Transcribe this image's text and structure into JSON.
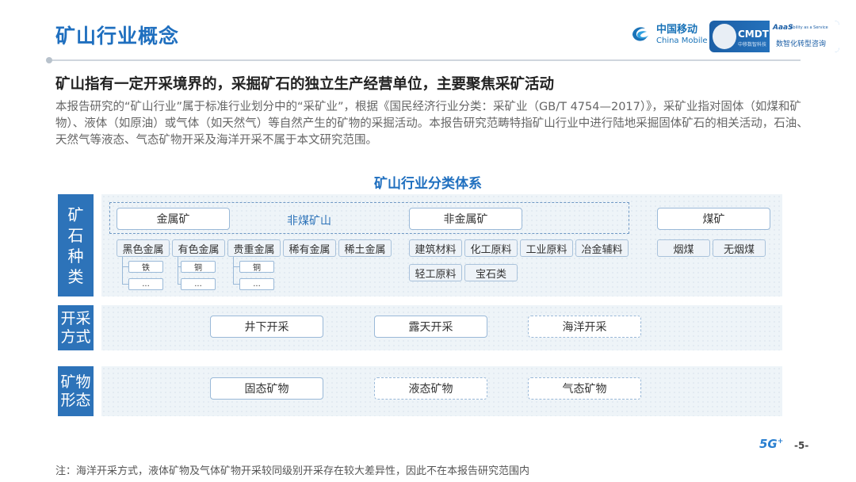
{
  "header": {
    "title": "矿山行业概念",
    "logo_cn": "中国移动",
    "logo_en": "China Mobile",
    "cmdt_brand": "CMDT",
    "cmdt_sub": "中移数智科技",
    "aas": "AaaS",
    "aas_tagline": "Ability as a Service",
    "cmdt_cn": "数智化转型咨询"
  },
  "headline": "矿山指有一定开采境界的，采掘矿石的独立生产经营单位，主要聚焦采矿活动",
  "paragraph": "本报告研究的“矿山行业”属于标准行业划分中的“采矿业”，根据《国民经济行业分类：采矿业（GB/T 4754—2017）》，采矿业指对固体（如煤和矿物）、液体（如原油）或气体（如天然气）等自然产生的矿物的采掘活动。本报告研究范畴特指矿山行业中进行陆地采掘固体矿石的相关活动，石油、天然气等液态、气态矿物开采及海洋开采不属于本文研究范围。",
  "system_title": "矿山行业分类体系",
  "rows": {
    "ore": {
      "label": "矿石种类",
      "nonmetal_group_label": "非煤矿山",
      "metal": "金属矿",
      "nonmetal": "非金属矿",
      "coal": "煤矿",
      "metal_tags": [
        "黑色金属",
        "有色金属",
        "贵重金属",
        "稀有金属",
        "稀土金属"
      ],
      "metal_leaves": [
        [
          "铁",
          "..."
        ],
        [
          "铜",
          "..."
        ],
        [
          "铜",
          "..."
        ]
      ],
      "nonmetal_tags": [
        "建筑材料",
        "化工原料",
        "工业原料",
        "冶金辅料",
        "轻工原料",
        "宝石类"
      ],
      "coal_tags": [
        "烟煤",
        "无烟煤"
      ]
    },
    "method": {
      "label": "开采方式",
      "items": [
        "井下开采",
        "露天开采",
        "海洋开采"
      ]
    },
    "form": {
      "label": "矿物形态",
      "items": [
        "固态矿物",
        "液态矿物",
        "气态矿物"
      ]
    }
  },
  "footnote": "注：海洋开采方式，液体矿物及气体矿物开采较同级别开采存在较大差异性，因此不在本报告研究范围内",
  "page": {
    "badge": "5G",
    "badge_sup": "+",
    "number": "-5-"
  }
}
